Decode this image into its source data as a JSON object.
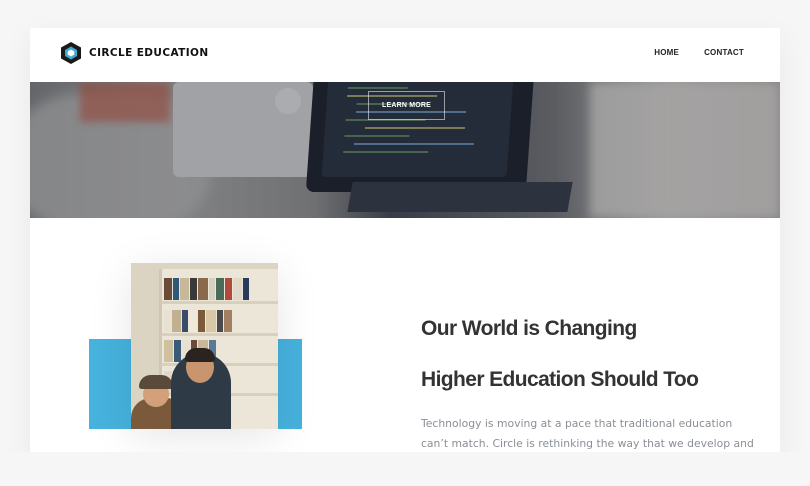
{
  "brand": {
    "name": "CIRCLE EDUCATION",
    "logo_icon": "hexagon-logo-icon",
    "logo_color": "#1a1a1a",
    "logo_accent": "#3fa9d6"
  },
  "nav": {
    "items": [
      {
        "label": "HOME"
      },
      {
        "label": "CONTACT"
      }
    ]
  },
  "hero": {
    "button_label": "LEARN MORE"
  },
  "content": {
    "heading_line1": "Our World is Changing",
    "heading_line2": "Higher Education Should Too",
    "paragraph": "Technology is moving at a pace that traditional education can’t match. Circle is rethinking the way that we develop and deliver"
  },
  "colors": {
    "accent_blue": "#46b2de",
    "text_dark": "#333333",
    "text_muted": "#8a8f96"
  }
}
